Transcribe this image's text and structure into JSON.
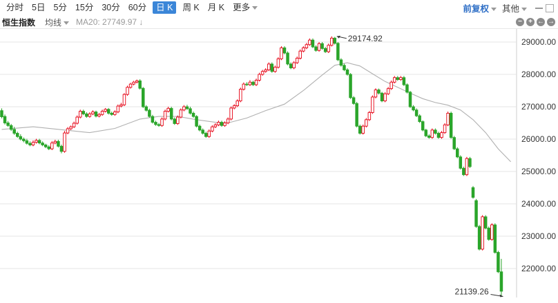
{
  "toolbar": {
    "tabs": [
      "分时",
      "5日",
      "5分",
      "15分",
      "30分",
      "60分",
      "日 K",
      "周 K",
      "月 K",
      "更多"
    ],
    "active": "日 K",
    "adjust_label": "前复权",
    "other_label": "其他"
  },
  "info": {
    "index_name": "恒生指数",
    "ma_type": "均线",
    "ma20_label": "MA20: 27749.97 ↓"
  },
  "controls": [
    "−",
    "+",
    "←",
    "→"
  ],
  "colors": {
    "up": "#e60012",
    "down": "#2aa52a",
    "ma": "#b0b0b0",
    "grid": "#e4e4e4"
  },
  "chart_data": {
    "type": "candlestick",
    "ylim": [
      21000,
      29300
    ],
    "yticks": [
      "29000.00",
      "28000.00",
      "27000.00",
      "26000.00",
      "25000.00",
      "24000.00",
      "23000.00",
      "22000.00"
    ],
    "annotations": [
      {
        "text": "29174.92",
        "value": 29174.92,
        "index": 106
      },
      {
        "text": "21139.26",
        "value": 21139.26,
        "index": 160
      }
    ],
    "candles": [
      [
        26880,
        26690,
        26950,
        26640
      ],
      [
        26700,
        26500,
        26760,
        26450
      ],
      [
        26500,
        26420,
        26560,
        26380
      ],
      [
        26420,
        26300,
        26470,
        26250
      ],
      [
        26300,
        26180,
        26380,
        26130
      ],
      [
        26180,
        26080,
        26230,
        26040
      ],
      [
        26080,
        26000,
        26150,
        25960
      ],
      [
        26000,
        25950,
        26050,
        25900
      ],
      [
        25950,
        25870,
        26010,
        25830
      ],
      [
        25870,
        25820,
        25930,
        25780
      ],
      [
        25820,
        25900,
        25960,
        25780
      ],
      [
        25900,
        25960,
        26010,
        25860
      ],
      [
        25960,
        25880,
        26010,
        25840
      ],
      [
        25880,
        25820,
        25930,
        25780
      ],
      [
        25820,
        25760,
        25860,
        25720
      ],
      [
        25760,
        25700,
        25810,
        25660
      ],
      [
        25700,
        25880,
        25940,
        25660
      ],
      [
        25880,
        25930,
        25980,
        25840
      ],
      [
        25930,
        25780,
        25980,
        25740
      ],
      [
        25780,
        25620,
        25830,
        25560
      ],
      [
        25620,
        26190,
        26250,
        25580
      ],
      [
        26190,
        26320,
        26370,
        26150
      ],
      [
        26320,
        26380,
        26420,
        26280
      ],
      [
        26380,
        26490,
        26540,
        26340
      ],
      [
        26490,
        26680,
        26730,
        26450
      ],
      [
        26680,
        26860,
        26910,
        26640
      ],
      [
        26860,
        26780,
        26910,
        26740
      ],
      [
        26780,
        26700,
        26830,
        26660
      ],
      [
        26700,
        26780,
        26830,
        26660
      ],
      [
        26780,
        26840,
        26890,
        26740
      ],
      [
        26840,
        26710,
        26880,
        26670
      ],
      [
        26710,
        26760,
        26810,
        26670
      ],
      [
        26760,
        26860,
        26910,
        26720
      ],
      [
        26860,
        26920,
        26960,
        26820
      ],
      [
        26920,
        26800,
        26960,
        26760
      ],
      [
        26800,
        26760,
        26850,
        26720
      ],
      [
        26760,
        26840,
        26890,
        26720
      ],
      [
        26840,
        27020,
        27070,
        26800
      ],
      [
        27020,
        27060,
        27120,
        26980
      ],
      [
        27060,
        27380,
        27420,
        27020
      ],
      [
        27380,
        27600,
        27650,
        27340
      ],
      [
        27600,
        27700,
        27740,
        27560
      ],
      [
        27700,
        27760,
        27800,
        27660
      ],
      [
        27760,
        27800,
        27840,
        27720
      ],
      [
        27800,
        27570,
        27850,
        27530
      ],
      [
        27570,
        27000,
        27610,
        26960
      ],
      [
        27000,
        26890,
        27050,
        26850
      ],
      [
        26890,
        26700,
        26940,
        26660
      ],
      [
        26700,
        26520,
        26750,
        26480
      ],
      [
        26520,
        26450,
        26570,
        26410
      ],
      [
        26450,
        26420,
        26500,
        26380
      ],
      [
        26420,
        26620,
        26670,
        26380
      ],
      [
        26620,
        26860,
        26910,
        26580
      ],
      [
        26860,
        26950,
        27000,
        26820
      ],
      [
        26950,
        26620,
        27000,
        26580
      ],
      [
        26620,
        26480,
        26670,
        26440
      ],
      [
        26480,
        26680,
        26730,
        26440
      ],
      [
        26680,
        26900,
        26950,
        26640
      ],
      [
        26900,
        27000,
        27050,
        26860
      ],
      [
        27000,
        26940,
        27060,
        26900
      ],
      [
        26940,
        26800,
        27000,
        26760
      ],
      [
        26800,
        26700,
        26850,
        26660
      ],
      [
        26700,
        26400,
        26740,
        26360
      ],
      [
        26400,
        26280,
        26450,
        26240
      ],
      [
        26280,
        26180,
        26330,
        26140
      ],
      [
        26180,
        26080,
        26230,
        26040
      ],
      [
        26080,
        26250,
        26300,
        26040
      ],
      [
        26250,
        26380,
        26430,
        26210
      ],
      [
        26380,
        26440,
        26490,
        26340
      ],
      [
        26440,
        26520,
        26570,
        26400
      ],
      [
        26520,
        26420,
        26570,
        26380
      ],
      [
        26420,
        26500,
        26550,
        26380
      ],
      [
        26500,
        26620,
        26670,
        26460
      ],
      [
        26620,
        26960,
        27010,
        26580
      ],
      [
        26960,
        27030,
        27080,
        26920
      ],
      [
        27030,
        27180,
        27230,
        26990
      ],
      [
        27180,
        27540,
        27590,
        27140
      ],
      [
        27540,
        27700,
        27750,
        27500
      ],
      [
        27700,
        27680,
        27760,
        27640
      ],
      [
        27680,
        27760,
        27820,
        27640
      ],
      [
        27760,
        27680,
        27800,
        27640
      ],
      [
        27680,
        27820,
        27870,
        27640
      ],
      [
        27820,
        28000,
        28050,
        27780
      ],
      [
        28000,
        28090,
        28140,
        27960
      ],
      [
        28090,
        28140,
        28190,
        28050
      ],
      [
        28140,
        28320,
        28370,
        28100
      ],
      [
        28320,
        28090,
        28370,
        28050
      ],
      [
        28090,
        28220,
        28270,
        28050
      ],
      [
        28220,
        28480,
        28530,
        28180
      ],
      [
        28480,
        28820,
        28870,
        28440
      ],
      [
        28820,
        28660,
        28870,
        28620
      ],
      [
        28660,
        28320,
        28710,
        28280
      ],
      [
        28320,
        28200,
        28370,
        28160
      ],
      [
        28200,
        28360,
        28410,
        28160
      ],
      [
        28360,
        28500,
        28550,
        28320
      ],
      [
        28500,
        28720,
        28770,
        28460
      ],
      [
        28720,
        28820,
        28870,
        28680
      ],
      [
        28820,
        28920,
        28970,
        28780
      ],
      [
        28920,
        29060,
        29110,
        28880
      ],
      [
        29060,
        28850,
        29110,
        28810
      ],
      [
        28850,
        28740,
        28900,
        28700
      ],
      [
        28740,
        28950,
        29000,
        28700
      ],
      [
        28950,
        28800,
        29000,
        28760
      ],
      [
        28800,
        28700,
        28850,
        28660
      ],
      [
        28700,
        28900,
        28950,
        28660
      ],
      [
        28900,
        29120,
        29174.92,
        28860
      ],
      [
        29120,
        28960,
        29160,
        28920
      ],
      [
        28960,
        28450,
        29000,
        28410
      ],
      [
        28450,
        28280,
        28500,
        28240
      ],
      [
        28280,
        28140,
        28330,
        28100
      ],
      [
        28140,
        28000,
        28190,
        27960
      ],
      [
        28000,
        27280,
        28040,
        27240
      ],
      [
        27280,
        27100,
        27330,
        27060
      ],
      [
        27100,
        26400,
        27150,
        26360
      ],
      [
        26400,
        26180,
        26450,
        26140
      ],
      [
        26180,
        26400,
        26450,
        26140
      ],
      [
        26400,
        26600,
        26650,
        26360
      ],
      [
        26600,
        26820,
        26870,
        26560
      ],
      [
        26820,
        27300,
        27350,
        26780
      ],
      [
        27300,
        27520,
        27570,
        27260
      ],
      [
        27520,
        27420,
        27560,
        27380
      ],
      [
        27420,
        27180,
        27460,
        27140
      ],
      [
        27180,
        27400,
        27450,
        27140
      ],
      [
        27400,
        27560,
        27610,
        27360
      ],
      [
        27560,
        27760,
        27810,
        27520
      ],
      [
        27760,
        27900,
        27950,
        27720
      ],
      [
        27900,
        27840,
        27950,
        27800
      ],
      [
        27840,
        27900,
        27950,
        27800
      ],
      [
        27900,
        27680,
        27950,
        27640
      ],
      [
        27680,
        27450,
        27720,
        27410
      ],
      [
        27450,
        27000,
        27490,
        26960
      ],
      [
        27000,
        26900,
        27050,
        26860
      ],
      [
        26900,
        26720,
        26950,
        26680
      ],
      [
        26720,
        26540,
        26770,
        26500
      ],
      [
        26540,
        26280,
        26580,
        26240
      ],
      [
        26280,
        26100,
        26320,
        26060
      ],
      [
        26100,
        26050,
        26150,
        26010
      ],
      [
        26050,
        26280,
        26330,
        26010
      ],
      [
        26280,
        26180,
        26330,
        26140
      ],
      [
        26180,
        26050,
        26230,
        26010
      ],
      [
        26050,
        26200,
        26250,
        26010
      ],
      [
        26200,
        26440,
        26490,
        26160
      ],
      [
        26440,
        26800,
        26850,
        26400
      ],
      [
        26800,
        26050,
        26850,
        26010
      ],
      [
        26050,
        25700,
        26100,
        25660
      ],
      [
        25700,
        25450,
        25750,
        25410
      ],
      [
        25450,
        25100,
        25500,
        25060
      ],
      [
        25100,
        24900,
        25150,
        24860
      ],
      [
        24900,
        25400,
        25450,
        24860
      ],
      [
        25400,
        25150,
        25450,
        25110
      ],
      [
        24500,
        24200,
        24550,
        24160
      ],
      [
        24100,
        23300,
        24150,
        23260
      ],
      [
        23300,
        22600,
        23350,
        22560
      ],
      [
        22600,
        23600,
        23650,
        22560
      ],
      [
        23600,
        23250,
        23650,
        23210
      ],
      [
        23250,
        22900,
        23300,
        22860
      ],
      [
        22900,
        23350,
        23400,
        22860
      ],
      [
        23350,
        22500,
        23400,
        22460
      ],
      [
        22500,
        21900,
        22550,
        21860
      ],
      [
        21900,
        21300,
        22300,
        21139.26
      ]
    ],
    "ma20": [
      [
        0,
        26300
      ],
      [
        10,
        26380
      ],
      [
        20,
        26280
      ],
      [
        28,
        26200
      ],
      [
        36,
        26330
      ],
      [
        44,
        26620
      ],
      [
        50,
        26700
      ],
      [
        56,
        26700
      ],
      [
        62,
        26600
      ],
      [
        68,
        26520
      ],
      [
        72,
        26500
      ],
      [
        78,
        26650
      ],
      [
        84,
        26880
      ],
      [
        90,
        27080
      ],
      [
        96,
        27500
      ],
      [
        102,
        27980
      ],
      [
        106,
        28280
      ],
      [
        110,
        28360
      ],
      [
        114,
        28260
      ],
      [
        118,
        28020
      ],
      [
        122,
        27780
      ],
      [
        126,
        27600
      ],
      [
        130,
        27420
      ],
      [
        134,
        27250
      ],
      [
        138,
        27130
      ],
      [
        142,
        27050
      ],
      [
        146,
        26900
      ],
      [
        150,
        26600
      ],
      [
        154,
        26200
      ],
      [
        158,
        25700
      ],
      [
        162,
        25300
      ]
    ]
  }
}
